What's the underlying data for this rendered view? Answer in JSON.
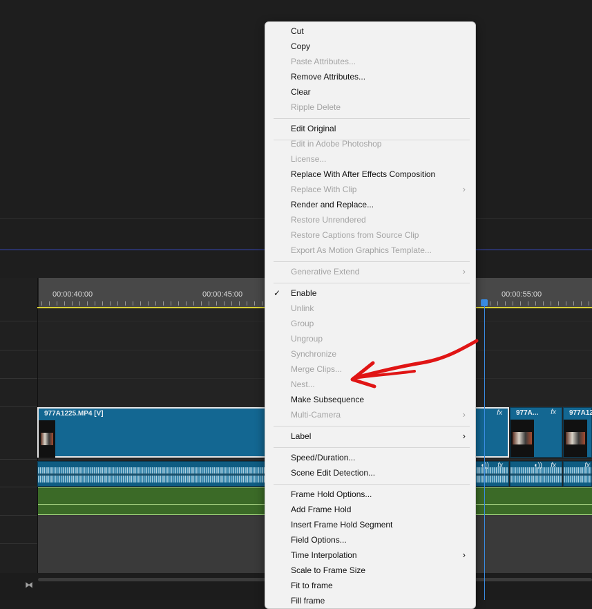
{
  "ruler": {
    "timecodes": [
      "00:00:40:00",
      "00:00:45:00",
      "00:00:55:00"
    ]
  },
  "clips": {
    "video": [
      {
        "name": "977A1225.MP4 [V]",
        "fx": "fx"
      },
      {
        "name": "977A...",
        "fx": "fx"
      },
      {
        "name": "977A12",
        "fx": ""
      }
    ],
    "audio_fx": [
      "fx",
      "fx",
      "fx"
    ]
  },
  "menu": {
    "items": [
      {
        "label": "Cut",
        "enabled": true
      },
      {
        "label": "Copy",
        "enabled": true
      },
      {
        "label": "Paste Attributes...",
        "enabled": false
      },
      {
        "label": "Remove Attributes...",
        "enabled": true
      },
      {
        "label": "Clear",
        "enabled": true
      },
      {
        "label": "Ripple Delete",
        "enabled": false
      },
      {
        "label": "Edit Original",
        "enabled": true
      },
      {
        "label": "Edit in Adobe Photoshop",
        "enabled": false
      },
      {
        "label": "License...",
        "enabled": false
      },
      {
        "label": "Replace With After Effects Composition",
        "enabled": true
      },
      {
        "label": "Replace With Clip",
        "enabled": false,
        "submenu": true
      },
      {
        "label": "Render and Replace...",
        "enabled": true
      },
      {
        "label": "Restore Unrendered",
        "enabled": false
      },
      {
        "label": "Restore Captions from Source Clip",
        "enabled": false
      },
      {
        "label": "Export As Motion Graphics Template...",
        "enabled": false
      },
      {
        "label": "Generative Extend",
        "enabled": false,
        "submenu": true
      },
      {
        "label": "Enable",
        "enabled": true,
        "checked": true
      },
      {
        "label": "Unlink",
        "enabled": false
      },
      {
        "label": "Group",
        "enabled": false
      },
      {
        "label": "Ungroup",
        "enabled": false
      },
      {
        "label": "Synchronize",
        "enabled": false
      },
      {
        "label": "Merge Clips...",
        "enabled": false
      },
      {
        "label": "Nest...",
        "enabled": false
      },
      {
        "label": "Make Subsequence",
        "enabled": true
      },
      {
        "label": "Multi-Camera",
        "enabled": false,
        "submenu": true
      },
      {
        "label": "Label",
        "enabled": true,
        "submenu": true
      },
      {
        "label": "Speed/Duration...",
        "enabled": true
      },
      {
        "label": "Scene Edit Detection...",
        "enabled": true
      },
      {
        "label": "Frame Hold Options...",
        "enabled": true
      },
      {
        "label": "Add Frame Hold",
        "enabled": true
      },
      {
        "label": "Insert Frame Hold Segment",
        "enabled": true
      },
      {
        "label": "Field Options...",
        "enabled": true
      },
      {
        "label": "Time Interpolation",
        "enabled": true,
        "submenu": true
      },
      {
        "label": "Scale to Frame Size",
        "enabled": true
      },
      {
        "label": "Fit to frame",
        "enabled": true
      },
      {
        "label": "Fill frame",
        "enabled": true
      }
    ],
    "submenu_glyph": "›",
    "check_glyph": "✓"
  },
  "colors": {
    "menu_bg": "#f2f2f2",
    "clip_video": "#136792",
    "clip_audio": "#0f5c82",
    "playhead": "#3b8ee6",
    "annotation_red": "#e01515"
  },
  "icons": [
    "collapse-tracks-icon",
    "checkmark-icon",
    "submenu-arrow-icon",
    "fx-badge-icon"
  ]
}
